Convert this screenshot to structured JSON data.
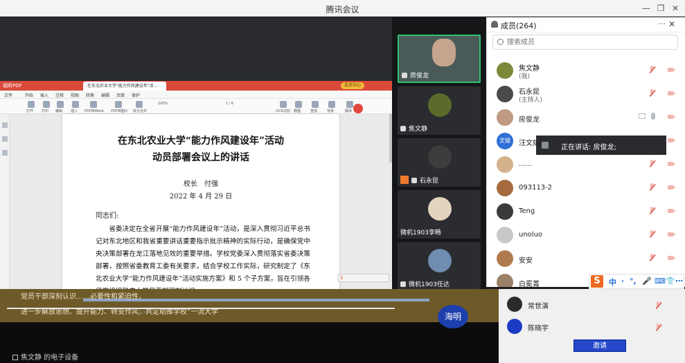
{
  "window": {
    "title": "腾讯会议",
    "minimize_icon": "minimize-icon",
    "restore_icon": "restore-icon",
    "close_icon": "close-icon"
  },
  "pdf_viewer": {
    "app_name": "福昕PDF",
    "tab_label": "在东北农业大学\"能力作风建设年\"活...",
    "member_badge": "会员中心",
    "menus": [
      "文件",
      "开始",
      "插入",
      "注释",
      "视图",
      "转换",
      "编辑",
      "页面",
      "保护"
    ],
    "tools": [
      "打开",
      "打印",
      "编辑",
      "插入",
      "PDF转Word",
      "PDF转图片",
      "拆分合并",
      "缩放",
      "翻页",
      "OCR识别",
      "截图",
      "查找",
      "背景",
      "翻译"
    ],
    "page_indicator": "1 / 6",
    "zoom": "100%",
    "document": {
      "title_line1": "在东北农业大学“能力作风建设年”活动",
      "title_line2": "动员部署会议上的讲话",
      "author": "校长　付强",
      "date": "2022 年 4 月 29 日",
      "salutation": "同志们:",
      "body": "省委决定在全省开展“能力作风建设年”活动，是深入贯彻习近平总书记对东北地区和我省重要讲话重要指示批示精神的实际行动，是确保党中央决策部署在龙江落地见效的重要举措。学校党委深入贯彻落实省委决策部署，按照省委教育工委有关要求，结合学校工作实际，研究制定了《东北农业大学“能力作风建设年”活动实施方案》和 5 个子方案，旨在引领各级党组织和广大党员干部深刻认识……"
    }
  },
  "video_tiles": [
    {
      "name": "房俊龙",
      "active": true
    },
    {
      "name": "焦文静",
      "active": false
    },
    {
      "name": "石永昆",
      "active": false,
      "sharing": true
    },
    {
      "name": "微机1903李畅",
      "active": false
    },
    {
      "name": "微机1903任达",
      "active": false
    }
  ],
  "members_panel": {
    "title": "成员(264)",
    "more": "···",
    "search_placeholder": "搜索成员",
    "members": [
      {
        "name": "焦文静",
        "role": "(我)",
        "avatar": "",
        "mic": "off",
        "cam": "off"
      },
      {
        "name": "石永昆",
        "role": "(主持人)",
        "avatar": "",
        "mic": "off",
        "cam": "off"
      },
      {
        "name": "房俊龙",
        "role": "",
        "avatar": "",
        "mic": "on",
        "cam": "off",
        "sharing": true
      },
      {
        "name": "汪文斌",
        "role": "",
        "avatar": "文斌",
        "mic": "off",
        "cam": "off"
      },
      {
        "name": "......",
        "role": "",
        "avatar": "",
        "mic": "off",
        "cam": "off"
      },
      {
        "name": "093113-2",
        "role": "",
        "avatar": "",
        "mic": "off",
        "cam": "off"
      },
      {
        "name": "Teng",
        "role": "",
        "avatar": "",
        "mic": "off",
        "cam": "off"
      },
      {
        "name": "unoluo",
        "role": "",
        "avatar": "",
        "mic": "off",
        "cam": "off"
      },
      {
        "name": "安安",
        "role": "",
        "avatar": "",
        "mic": "off",
        "cam": "off"
      },
      {
        "name": "白冕菁",
        "role": "",
        "avatar": "",
        "mic": "off",
        "cam": "off"
      }
    ],
    "lower_members": [
      "常世演",
      "陈晓宇"
    ],
    "invite_button": "邀请",
    "speaking_label": "正在讲话: 房俊龙;"
  },
  "ime": {
    "logo": "S",
    "keys": [
      "中",
      "·",
      "°,",
      "🎤",
      "⌨",
      "👕",
      "⋯"
    ]
  },
  "overlay": {
    "subtitle_line1": "党员干部深刻认识……必要性和紧迫性，",
    "subtitle_line2": "进一步解放思想、提升能力、转变作风，共定助推学校“一流大学",
    "name_badge": "海明",
    "footer_status": "焦文静 的电子设备",
    "page_bottom": "1/4"
  },
  "colors": {
    "accent_green": "#2ec26e",
    "pdf_red": "#d94a3a",
    "muted_red": "#e06c63",
    "ime_orange": "#ee6a20"
  }
}
